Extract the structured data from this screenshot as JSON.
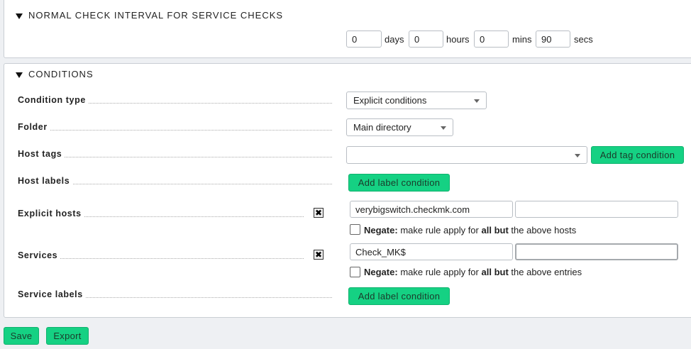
{
  "interval": {
    "title": "NORMAL CHECK INTERVAL FOR SERVICE CHECKS",
    "days_value": "0",
    "days_unit": "days",
    "hours_value": "0",
    "hours_unit": "hours",
    "mins_value": "0",
    "mins_unit": "mins",
    "secs_value": "90",
    "secs_unit": "secs"
  },
  "conditions": {
    "title": "CONDITIONS",
    "condition_type": {
      "label": "Condition type",
      "value": "Explicit conditions"
    },
    "folder": {
      "label": "Folder",
      "value": "Main directory"
    },
    "host_tags": {
      "label": "Host tags",
      "value": "",
      "button": "Add tag condition"
    },
    "host_labels": {
      "label": "Host labels",
      "button": "Add label condition"
    },
    "explicit_hosts": {
      "label": "Explicit hosts",
      "delete_glyph": "✖",
      "value1": "verybigswitch.checkmk.com",
      "value2": "",
      "negate_label": "Negate:",
      "negate_pre": "make rule apply for",
      "negate_bold": "all but",
      "negate_post": "the above hosts"
    },
    "services": {
      "label": "Services",
      "delete_glyph": "✖",
      "value1": "Check_MK$",
      "value2": "",
      "negate_label": "Negate:",
      "negate_pre": "make rule apply for",
      "negate_bold": "all but",
      "negate_post": "the above entries"
    },
    "service_labels": {
      "label": "Service labels",
      "button": "Add label condition"
    }
  },
  "footer": {
    "save": "Save",
    "export": "Export"
  }
}
